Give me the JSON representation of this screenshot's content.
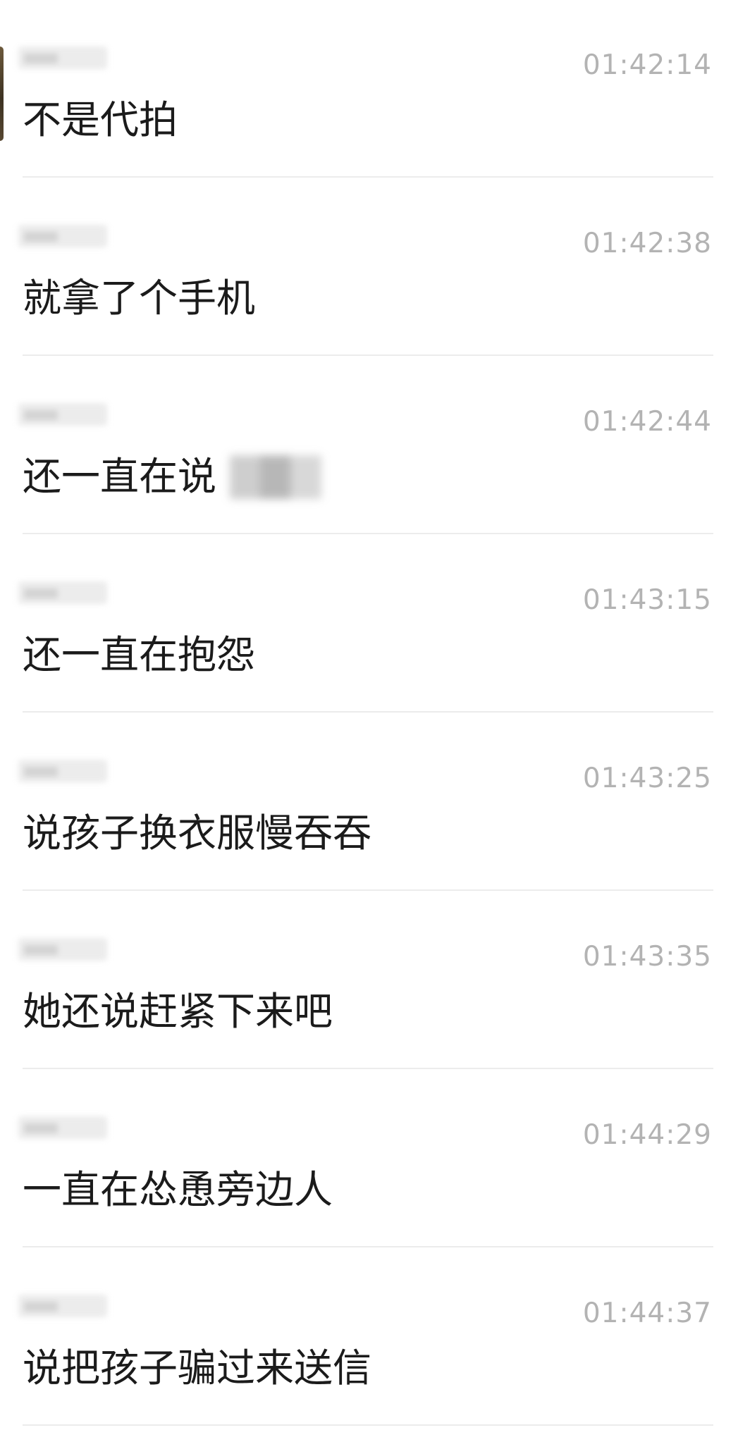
{
  "messages": [
    {
      "time": "01:42:14",
      "text": "不是代拍"
    },
    {
      "time": "01:42:38",
      "text": "就拿了个手机"
    },
    {
      "time": "01:42:44",
      "text": "还一直在说",
      "redacted_suffix": true
    },
    {
      "time": "01:43:15",
      "text": "还一直在抱怨"
    },
    {
      "time": "01:43:25",
      "text": "说孩子换衣服慢吞吞"
    },
    {
      "time": "01:43:35",
      "text": "她还说赶紧下来吧"
    },
    {
      "time": "01:44:29",
      "text": "一直在怂恿旁边人"
    },
    {
      "time": "01:44:37",
      "text": "说把孩子骗过来送信"
    }
  ],
  "colors": {
    "background": "#ffffff",
    "timestamp": "#b3b3b3",
    "message_text": "#1b1b1b",
    "divider": "#ececec"
  }
}
